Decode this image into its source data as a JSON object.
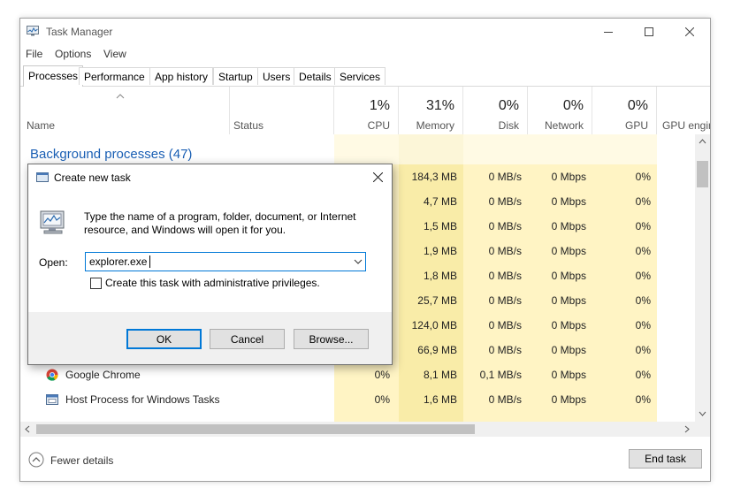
{
  "window": {
    "title": "Task Manager",
    "minimize_glyph": "—",
    "maximize_glyph": "☐",
    "close_glyph": "✕"
  },
  "menu": [
    "File",
    "Options",
    "View"
  ],
  "tabs": [
    "Processes",
    "Performance",
    "App history",
    "Startup",
    "Users",
    "Details",
    "Services"
  ],
  "active_tab": "Processes",
  "columns": {
    "name": "Name",
    "status": "Status",
    "cpu": {
      "pct": "1%",
      "label": "CPU"
    },
    "memory": {
      "pct": "31%",
      "label": "Memory"
    },
    "disk": {
      "pct": "0%",
      "label": "Disk"
    },
    "network": {
      "pct": "0%",
      "label": "Network"
    },
    "gpu": {
      "pct": "0%",
      "label": "GPU"
    },
    "gpu_engine": "GPU engin"
  },
  "group": {
    "label": "Background processes (47)"
  },
  "rows": [
    {
      "name": "",
      "cpu": "",
      "memory": "184,3 MB",
      "disk": "0 MB/s",
      "network": "0 Mbps",
      "gpu": "0%"
    },
    {
      "name": "",
      "cpu": "",
      "memory": "4,7 MB",
      "disk": "0 MB/s",
      "network": "0 Mbps",
      "gpu": "0%"
    },
    {
      "name": "",
      "cpu": "",
      "memory": "1,5 MB",
      "disk": "0 MB/s",
      "network": "0 Mbps",
      "gpu": "0%"
    },
    {
      "name": "",
      "cpu": "",
      "memory": "1,9 MB",
      "disk": "0 MB/s",
      "network": "0 Mbps",
      "gpu": "0%"
    },
    {
      "name": "",
      "cpu": "",
      "memory": "1,8 MB",
      "disk": "0 MB/s",
      "network": "0 Mbps",
      "gpu": "0%"
    },
    {
      "name": "",
      "cpu": "",
      "memory": "25,7 MB",
      "disk": "0 MB/s",
      "network": "0 Mbps",
      "gpu": "0%"
    },
    {
      "name": "",
      "cpu": "",
      "memory": "124,0 MB",
      "disk": "0 MB/s",
      "network": "0 Mbps",
      "gpu": "0%"
    },
    {
      "name": "",
      "cpu": "",
      "memory": "66,9 MB",
      "disk": "0 MB/s",
      "network": "0 Mbps",
      "gpu": "0%"
    },
    {
      "name": "Google Chrome",
      "cpu": "0%",
      "memory": "8,1 MB",
      "disk": "0,1 MB/s",
      "network": "0 Mbps",
      "gpu": "0%"
    },
    {
      "name": "Host Process for Windows Tasks",
      "cpu": "0%",
      "memory": "1,6 MB",
      "disk": "0 MB/s",
      "network": "0 Mbps",
      "gpu": "0%"
    }
  ],
  "footer": {
    "fewer_details": "Fewer details",
    "end_task": "End task"
  },
  "dialog": {
    "title": "Create new task",
    "message": "Type the name of a program, folder, document, or Internet resource, and Windows will open it for you.",
    "open_label": "Open:",
    "open_value": "explorer.exe",
    "admin_label": "Create this task with administrative privileges.",
    "admin_checked": false,
    "ok": "OK",
    "cancel": "Cancel",
    "browse": "Browse...",
    "close_glyph": "✕"
  },
  "colors": {
    "heat_light": "#fff4c4",
    "heat_mid": "#f9eca8",
    "group_blue": "#1a5fb4",
    "accent_focus": "#0078d7"
  },
  "icons": [
    "task-manager-icon",
    "chrome-icon",
    "host-process-icon",
    "run-dialog-icon",
    "computer-monitor-icon",
    "chevron-down-icon",
    "sort-up-icon",
    "fewer-details-icon"
  ]
}
